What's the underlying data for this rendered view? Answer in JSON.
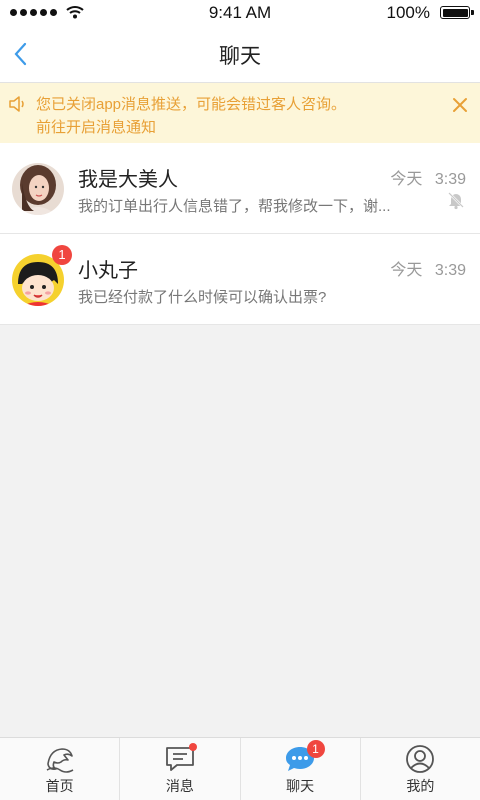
{
  "status_bar": {
    "time": "9:41 AM",
    "battery": "100%"
  },
  "nav": {
    "title": "聊天",
    "back_icon": "chevron-left-icon"
  },
  "notice": {
    "line1": "您已关闭app消息推送，可能会错过客人咨询。",
    "line2": "前往开启消息通知",
    "color": "#e8a036",
    "background": "#fdf6d9"
  },
  "chats": [
    {
      "name": "我是大美人",
      "day": "今天",
      "time": "3:39",
      "preview": "我的订单出行人信息错了，帮我修改一下，谢...",
      "muted": true
    },
    {
      "name": "小丸子",
      "day": "今天",
      "time": "3:39",
      "preview": "我已经付款了什么时候可以确认出票?",
      "badge": "1"
    }
  ],
  "tabs": [
    {
      "label": "首页",
      "icon": "home-dolphin-icon"
    },
    {
      "label": "消息",
      "icon": "message-icon"
    },
    {
      "label": "聊天",
      "icon": "chat-bubble-icon",
      "badge": "1",
      "active_color": "#3d9be9"
    },
    {
      "label": "我的",
      "icon": "profile-icon"
    }
  ]
}
